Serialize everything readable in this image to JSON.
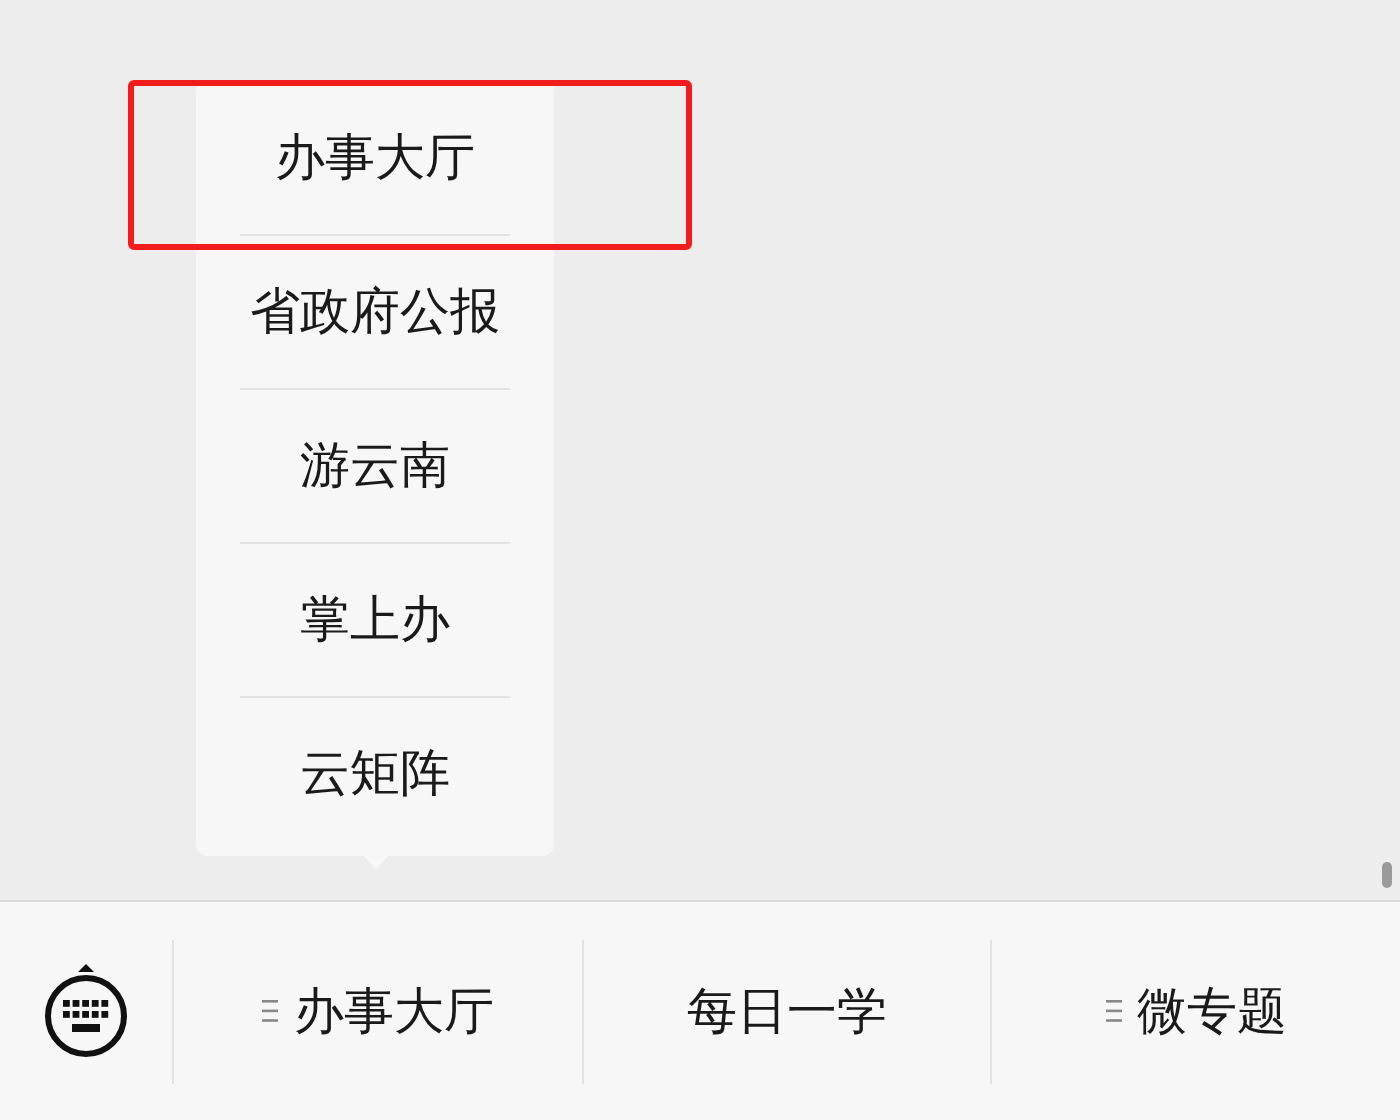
{
  "popup_menu": {
    "items": [
      {
        "label": "办事大厅",
        "highlighted": true
      },
      {
        "label": "省政府公报",
        "highlighted": false
      },
      {
        "label": "游云南",
        "highlighted": false
      },
      {
        "label": "掌上办",
        "highlighted": false
      },
      {
        "label": "云矩阵",
        "highlighted": false
      }
    ]
  },
  "bottom_menu": [
    {
      "label": "办事大厅",
      "has_submenu": true
    },
    {
      "label": "每日一学",
      "has_submenu": false
    },
    {
      "label": "微专题",
      "has_submenu": true
    }
  ]
}
